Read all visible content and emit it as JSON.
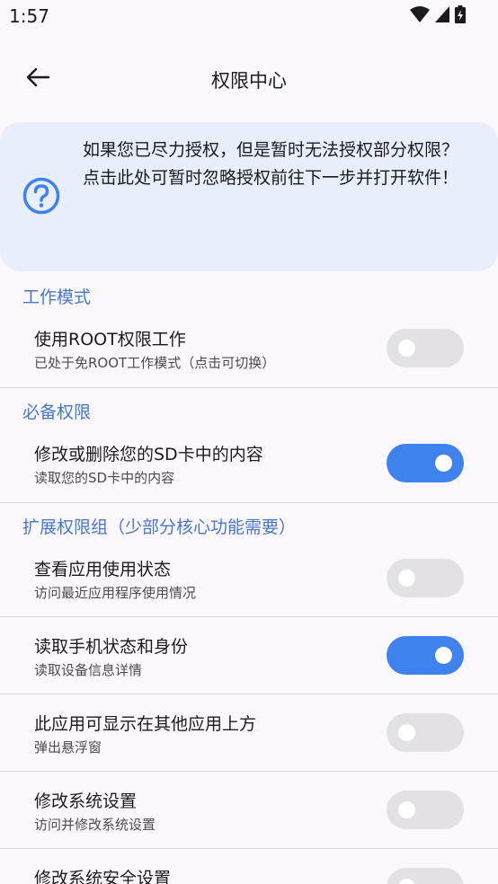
{
  "status_bar": {
    "time": "1:57"
  },
  "app_bar": {
    "title": "权限中心"
  },
  "info_card": {
    "text": "如果您已尽力授权，但是暂时无法授权部分权限？\n点击此处可暂时忽略授权前往下一步并打开软件！"
  },
  "sections": {
    "work_mode": "工作模式",
    "required": "必备权限",
    "extended": "扩展权限组（少部分核心功能需要）"
  },
  "rows": [
    {
      "title": "使用ROOT权限工作",
      "subtitle": "已处于免ROOT工作模式（点击可切换）",
      "enabled": false
    },
    {
      "title": "修改或删除您的SD卡中的内容",
      "subtitle": "读取您的SD卡中的内容",
      "enabled": true
    },
    {
      "title": "查看应用使用状态",
      "subtitle": "访问最近应用程序使用情况",
      "enabled": false
    },
    {
      "title": "读取手机状态和身份",
      "subtitle": "读取设备信息详情",
      "enabled": true
    },
    {
      "title": "此应用可显示在其他应用上方",
      "subtitle": "弹出悬浮窗",
      "enabled": false
    },
    {
      "title": "修改系统设置",
      "subtitle": "访问并修改系统设置",
      "enabled": false
    },
    {
      "title": "修改系统安全设置",
      "subtitle": "",
      "enabled": false
    }
  ],
  "colors": {
    "accent": "#3f82ee",
    "section": "#4677c9",
    "card": "#e8eefb",
    "toggle_off": "#e3e1e6"
  }
}
